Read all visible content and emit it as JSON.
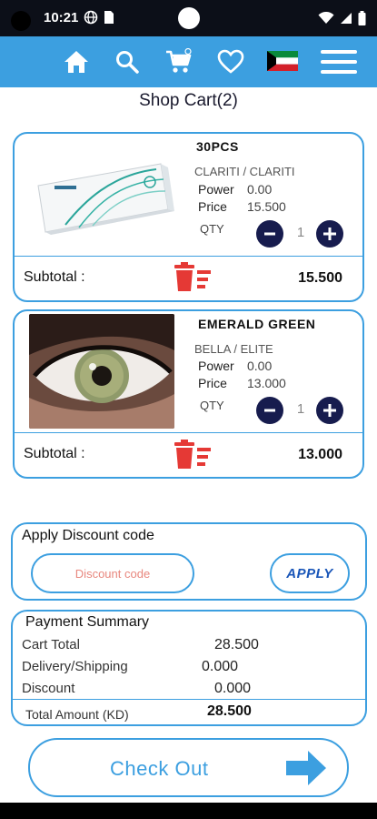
{
  "status": {
    "time": "10:21"
  },
  "colors": {
    "accent": "#3c9fe0",
    "navy": "#171c4e",
    "delete": "#e53935",
    "placeholder": "#e8877e"
  },
  "nav": {
    "icons": [
      "home-icon",
      "search-icon",
      "cart-icon",
      "heart-icon",
      "kuwait-flag-icon",
      "menu-icon"
    ]
  },
  "page": {
    "title": "Shop Cart(2)"
  },
  "cart": {
    "items": [
      {
        "name": "30PCS",
        "brand_line": "CLARITI /  CLARITI",
        "power_label": "Power",
        "power": "0.00",
        "price_label": "Price",
        "price": "15.500",
        "qty_label": "QTY",
        "qty": "1",
        "subtotal_label": "Subtotal :",
        "subtotal": "15.500"
      },
      {
        "name": "EMERALD GREEN",
        "brand_line": "BELLA /  ELITE",
        "power_label": "Power",
        "power": "0.00",
        "price_label": "Price",
        "price": "13.000",
        "qty_label": "QTY",
        "qty": "1",
        "subtotal_label": "Subtotal :",
        "subtotal": "13.000"
      }
    ]
  },
  "discount": {
    "title": "Apply Discount code",
    "placeholder": "Discount code",
    "apply_label": "APPLY"
  },
  "payment": {
    "title": "Payment Summary",
    "rows": [
      {
        "label": "Cart Total",
        "value": "28.500"
      },
      {
        "label": "Delivery/Shipping",
        "value": "0.000"
      },
      {
        "label": "Discount",
        "value": "0.000"
      }
    ],
    "total_label": "Total Amount (KD)",
    "total_value": "28.500"
  },
  "checkout": {
    "label": "Check Out"
  }
}
